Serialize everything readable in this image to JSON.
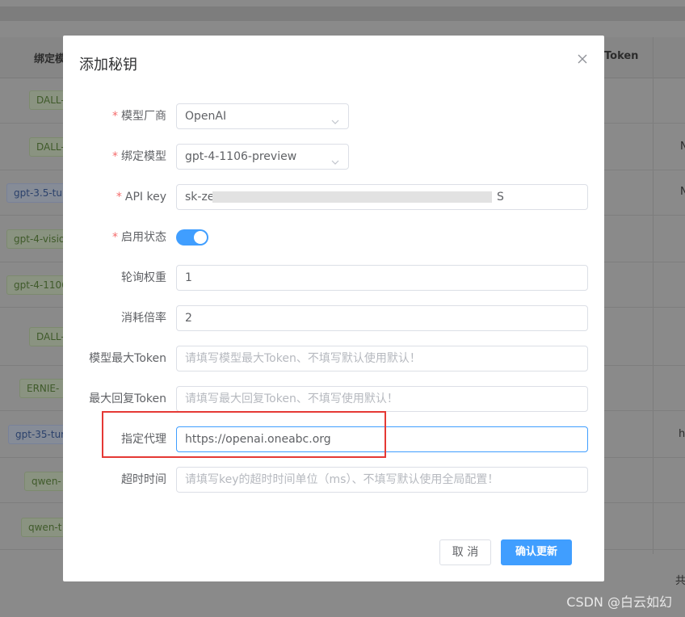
{
  "background": {
    "header_cells": [
      "绑定模",
      "Token"
    ],
    "tags": [
      {
        "text": "DALL-",
        "kind": "g"
      },
      {
        "text": "DALL-",
        "kind": "g"
      },
      {
        "text": "gpt-3.5-tur",
        "kind": "b"
      },
      {
        "text": "gpt-4-visio",
        "kind": "g"
      },
      {
        "text": "gpt-4-1106",
        "kind": "g"
      },
      {
        "text": "DALL-",
        "kind": "g"
      },
      {
        "text": "ERNIE-",
        "kind": "g"
      },
      {
        "text": "gpt-35-tur",
        "kind": "b"
      },
      {
        "text": "qwen-",
        "kind": "g"
      },
      {
        "text": "qwen-t",
        "kind": "g"
      }
    ],
    "edge_chars": [
      "N",
      "N",
      "h"
    ],
    "footer_char": "共"
  },
  "dialog": {
    "title": "添加秘钥",
    "close_icon": "close-icon",
    "fields": {
      "vendor": {
        "label": "模型厂商",
        "required": true,
        "value": "OpenAI"
      },
      "model": {
        "label": "绑定模型",
        "required": true,
        "value": "gpt-4-1106-preview"
      },
      "api_key": {
        "label": "API key",
        "required": true,
        "value_start": "sk-ze",
        "value_end": "S"
      },
      "status": {
        "label": "启用状态",
        "required": true,
        "enabled": true
      },
      "weight": {
        "label": "轮询权重",
        "value": "1"
      },
      "rate": {
        "label": "消耗倍率",
        "value": "2"
      },
      "max_token": {
        "label": "模型最大Token",
        "placeholder": "请填写模型最大Token、不填写默认使用默认！"
      },
      "max_reply_token": {
        "label": "最大回复Token",
        "placeholder": "请填写最大回复Token、不填写使用默认！"
      },
      "proxy": {
        "label": "指定代理",
        "value": "https://openai.oneabc.org"
      },
      "timeout": {
        "label": "超时时间",
        "placeholder": "请填写key的超时时间单位（ms）、不填写默认使用全局配置！"
      }
    },
    "buttons": {
      "cancel": "取 消",
      "confirm": "确认更新"
    }
  },
  "watermark": "CSDN @白云如幻",
  "colors": {
    "primary": "#409eff",
    "required": "#f56c6c",
    "highlight": "#e53935"
  }
}
